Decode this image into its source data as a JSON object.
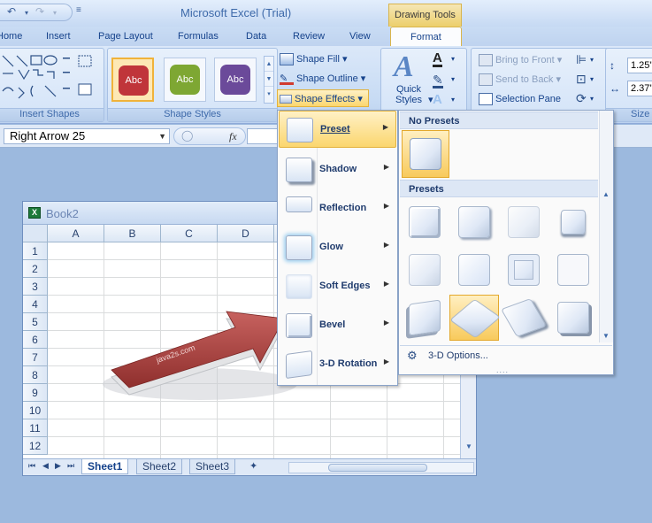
{
  "app_title": "Microsoft Excel (Trial)",
  "contextual_header": "Drawing Tools",
  "tabs": [
    "Home",
    "Insert",
    "Page Layout",
    "Formulas",
    "Data",
    "Review",
    "View",
    "Format"
  ],
  "active_tab": "Format",
  "ribbon": {
    "insert_shapes_label": "Insert Shapes",
    "shape_styles_label": "Shape Styles",
    "style_thumbs": [
      {
        "text": "Abc",
        "color": "#c0353a"
      },
      {
        "text": "Abc",
        "color": "#7ea733"
      },
      {
        "text": "Abc",
        "color": "#6b4a9a"
      }
    ],
    "shape_fill": "Shape Fill",
    "shape_outline": "Shape Outline",
    "shape_effects": "Shape Effects",
    "quick_styles": "Quick Styles",
    "bring_to_front": "Bring to Front",
    "send_to_back": "Send to Back",
    "selection_pane": "Selection Pane",
    "height_value": "1.25\"",
    "width_value": "2.37\"",
    "size_label": "Size"
  },
  "formula_bar": {
    "name_box": "Right Arrow 25",
    "fx": "fx"
  },
  "workbook": {
    "title": "Book2",
    "columns": [
      "A",
      "B",
      "C",
      "D"
    ],
    "rows": [
      "1",
      "2",
      "3",
      "4",
      "5",
      "6",
      "7",
      "8",
      "9",
      "10",
      "11",
      "12"
    ],
    "sheets": [
      "Sheet1",
      "Sheet2",
      "Sheet3"
    ],
    "active_sheet": "Sheet1",
    "arrow_watermark": "java2s.com"
  },
  "effects_menu": {
    "items": [
      "Preset",
      "Shadow",
      "Reflection",
      "Glow",
      "Soft Edges",
      "Bevel",
      "3-D Rotation"
    ],
    "highlighted": "Preset"
  },
  "presets_flyout": {
    "no_presets_header": "No Presets",
    "presets_header": "Presets",
    "options_label": "3-D Options...",
    "grip": "....",
    "highlighted_preset_index": 9
  },
  "colors": {
    "accent_highlight": "#fbd66e",
    "ribbon_blue": "#c7dbf4",
    "arrow_red": "#b24a47"
  }
}
